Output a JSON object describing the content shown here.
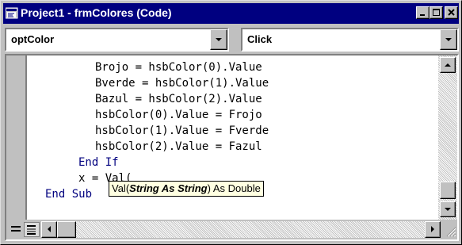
{
  "window": {
    "title": "Project1 - frmColores (Code)"
  },
  "title_buttons": {
    "minimize": "minimize-icon",
    "maximize": "maximize-icon",
    "close": "close-icon"
  },
  "object_combo": {
    "value": "optColor"
  },
  "procedure_combo": {
    "value": "Click"
  },
  "code": {
    "lines": [
      "Brojo = hsbColor(0).Value",
      "Bverde = hsbColor(1).Value",
      "Bazul = hsbColor(2).Value",
      "hsbColor(0).Value = Frojo",
      "hsbColor(1).Value = Fverde",
      "hsbColor(2).Value = Fazul",
      "End If",
      "x = Val(",
      "End Sub"
    ]
  },
  "tooltip": {
    "prefix": "Val(",
    "param": "String As String",
    "suffix": ") As Double"
  },
  "colors": {
    "title_bar": "#000080",
    "keyword": "#00007f",
    "tooltip_bg": "#ffffe1",
    "window_bg": "#c0c0c0"
  }
}
